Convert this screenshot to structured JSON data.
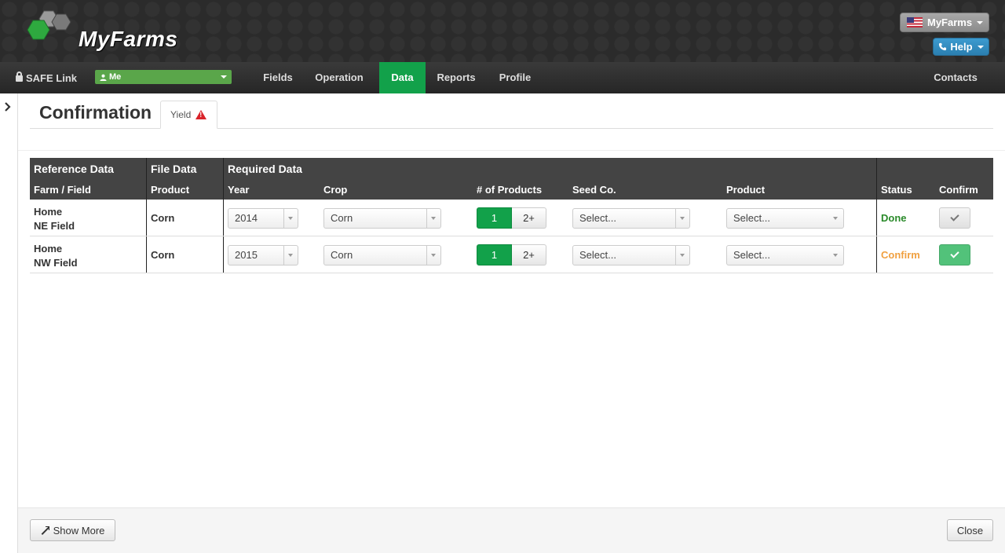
{
  "header": {
    "logo_text": "MyFarms",
    "account_label": "MyFarms",
    "help_label": "Help"
  },
  "navbar": {
    "safe_link": "SAFE Link",
    "user_select": "Me",
    "items": [
      {
        "label": "Fields"
      },
      {
        "label": "Operation"
      },
      {
        "label": "Data",
        "active": true
      },
      {
        "label": "Reports"
      },
      {
        "label": "Profile"
      }
    ],
    "contacts": "Contacts"
  },
  "page": {
    "title": "Confirmation",
    "tab_label": "Yield"
  },
  "table": {
    "groups": {
      "reference": "Reference Data",
      "file": "File Data",
      "required": "Required Data"
    },
    "columns": {
      "farm_field": "Farm / Field",
      "product_file": "Product",
      "year": "Year",
      "crop": "Crop",
      "num_products": "# of Products",
      "seed_co": "Seed Co.",
      "product": "Product",
      "status": "Status",
      "confirm": "Confirm"
    },
    "rows": [
      {
        "farm": "Home",
        "field": "NE Field",
        "file_product": "Corn",
        "year": "2014",
        "crop": "Corn",
        "seg_one": "1",
        "seg_two": "2+",
        "seed_co": "Select...",
        "product": "Select...",
        "status": "Done",
        "status_color": "#2a8a2a"
      },
      {
        "farm": "Home",
        "field": "NW Field",
        "file_product": "Corn",
        "year": "2015",
        "crop": "Corn",
        "seg_one": "1",
        "seg_two": "2+",
        "seed_co": "Select...",
        "product": "Select...",
        "status": "Confirm",
        "status_color": "#f0a040"
      }
    ]
  },
  "footer": {
    "show_more": "Show More",
    "close": "Close"
  },
  "colors": {
    "accent_green": "#12a14a",
    "header_dark": "#2b2b2b",
    "help_blue": "#2b7fb0"
  }
}
